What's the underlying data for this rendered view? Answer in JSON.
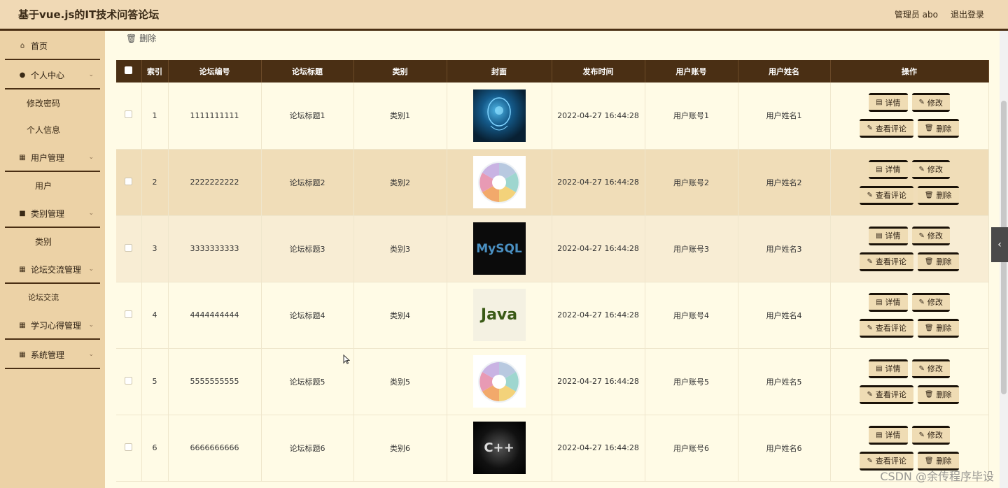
{
  "header": {
    "title": "基于vue.js的IT技术问答论坛",
    "user": "管理员 abo",
    "logout": "退出登录"
  },
  "sidebar": {
    "home": "首页",
    "personal_center": "个人中心",
    "change_password": "修改密码",
    "personal_info": "个人信息",
    "user_mgmt": "用户管理",
    "user": "用户",
    "category_mgmt": "类别管理",
    "category": "类别",
    "forum_mgmt": "论坛交流管理",
    "forum": "论坛交流",
    "learning_mgmt": "学习心得管理",
    "system_mgmt": "系统管理"
  },
  "toolbar": {
    "delete_label": "删除"
  },
  "table": {
    "headers": [
      "",
      "索引",
      "论坛编号",
      "论坛标题",
      "类别",
      "封面",
      "发布时间",
      "用户账号",
      "用户姓名",
      "操作"
    ],
    "buttons": {
      "detail": "详情",
      "edit": "修改",
      "comments": "查看评论",
      "delete": "删除"
    },
    "rows": [
      {
        "index": "1",
        "code": "1111111111",
        "title": "论坛标题1",
        "category": "类别1",
        "cover": "ai-head",
        "time": "2022-04-27 16:44:28",
        "account": "用户账号1",
        "name": "用户姓名1"
      },
      {
        "index": "2",
        "code": "2222222222",
        "title": "论坛标题2",
        "category": "类别2",
        "cover": "language-wheel",
        "time": "2022-04-27 16:44:28",
        "account": "用户账号2",
        "name": "用户姓名2"
      },
      {
        "index": "3",
        "code": "3333333333",
        "title": "论坛标题3",
        "category": "类别3",
        "cover": "mysql-logo",
        "cover_text": "MySQL",
        "time": "2022-04-27 16:44:28",
        "account": "用户账号3",
        "name": "用户姓名3"
      },
      {
        "index": "4",
        "code": "4444444444",
        "title": "论坛标题4",
        "category": "类别4",
        "cover": "java-wordcloud",
        "cover_text": "Java",
        "time": "2022-04-27 16:44:28",
        "account": "用户账号4",
        "name": "用户姓名4"
      },
      {
        "index": "5",
        "code": "5555555555",
        "title": "论坛标题5",
        "category": "类别5",
        "cover": "language-wheel",
        "time": "2022-04-27 16:44:28",
        "account": "用户账号5",
        "name": "用户姓名5"
      },
      {
        "index": "6",
        "code": "6666666666",
        "title": "论坛标题6",
        "category": "类别6",
        "cover": "cpp-wordcloud",
        "cover_text": "C++",
        "time": "2022-04-27 16:44:28",
        "account": "用户账号6",
        "name": "用户姓名6"
      }
    ]
  },
  "watermark": "CSDN @余传程序毕设",
  "colors": {
    "header_bg": "#f0d9b5",
    "sidebar_bg": "#ecd2a6",
    "table_head_bg": "#4a2f14",
    "page_bg": "#fffbe6"
  }
}
